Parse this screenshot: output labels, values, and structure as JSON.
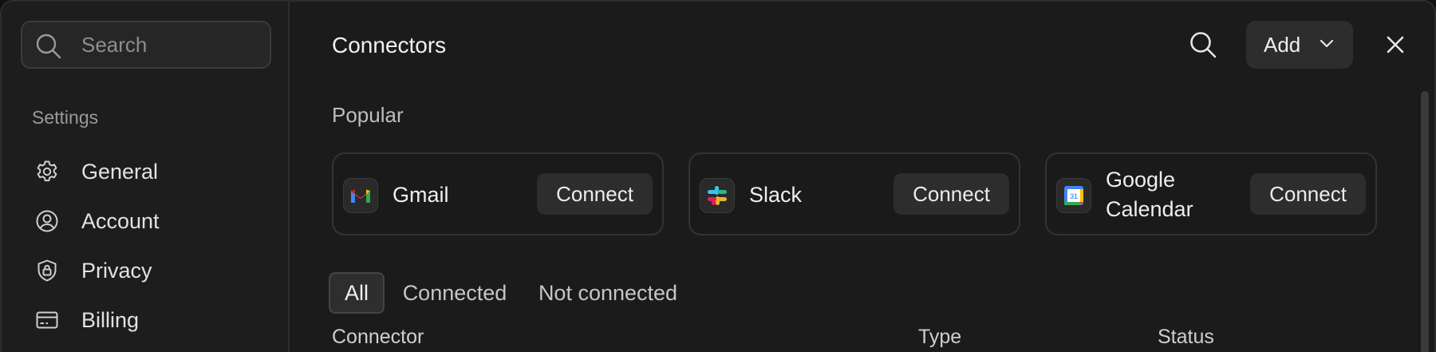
{
  "sidebar": {
    "search_placeholder": "Search",
    "section_label": "Settings",
    "items": [
      {
        "label": "General",
        "icon": "gear-icon"
      },
      {
        "label": "Account",
        "icon": "user-circle-icon"
      },
      {
        "label": "Privacy",
        "icon": "shield-lock-icon"
      },
      {
        "label": "Billing",
        "icon": "credit-card-icon"
      }
    ]
  },
  "header": {
    "title": "Connectors",
    "search_icon": "search-icon",
    "add_label": "Add",
    "close_icon": "close-icon"
  },
  "popular": {
    "label": "Popular",
    "cards": [
      {
        "name": "Gmail",
        "button": "Connect",
        "icon": "gmail-icon"
      },
      {
        "name": "Slack",
        "button": "Connect",
        "icon": "slack-icon"
      },
      {
        "name_line1": "Google",
        "name_line2": "Calendar",
        "button": "Connect",
        "icon": "google-calendar-icon",
        "icon_text": "31"
      }
    ]
  },
  "tabs": [
    {
      "label": "All",
      "active": true
    },
    {
      "label": "Connected",
      "active": false
    },
    {
      "label": "Not connected",
      "active": false
    }
  ],
  "table": {
    "columns": [
      "Connector",
      "Type",
      "Status"
    ]
  },
  "colors": {
    "background": "#1b1b1b",
    "sidebar": "#1d1d1d",
    "button": "#2d2d2d",
    "text": "#ececec"
  }
}
